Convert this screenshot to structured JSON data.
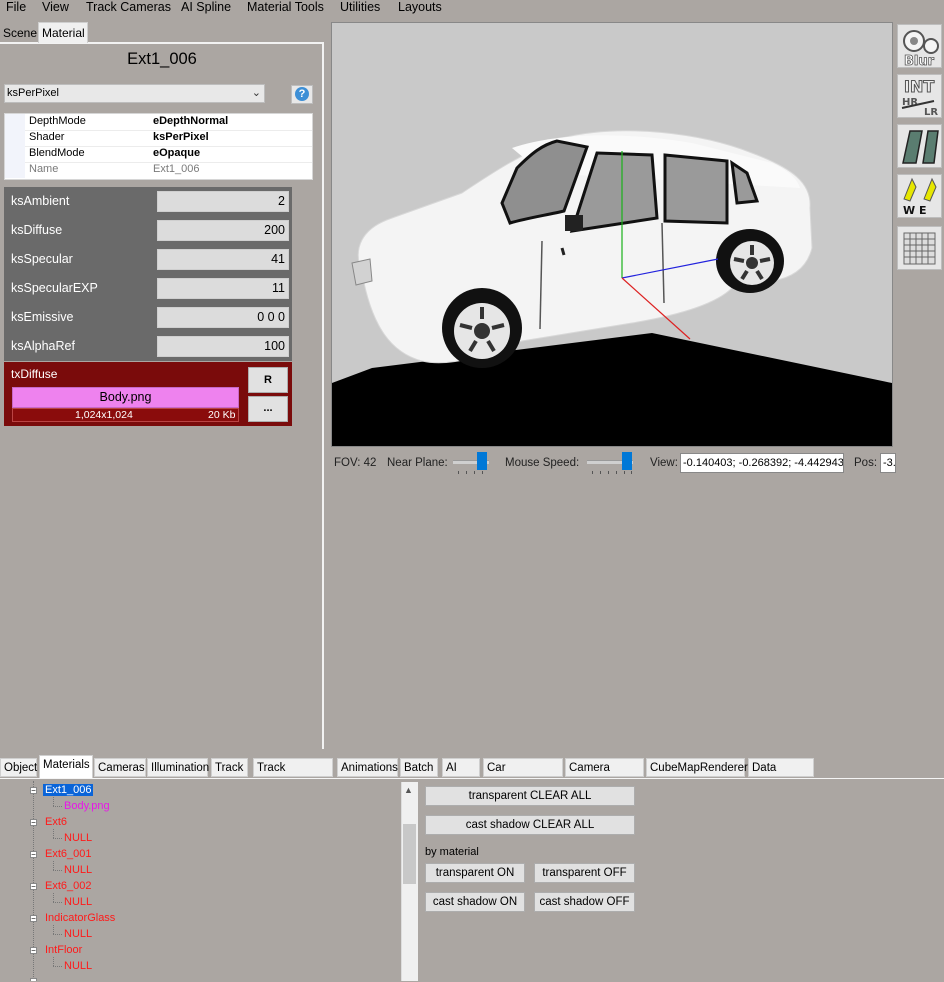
{
  "menu": [
    "File",
    "View",
    "Track Cameras",
    "AI Spline",
    "Material Tools",
    "Utilities",
    "Layouts"
  ],
  "left_tabs": [
    "Scene",
    "Material"
  ],
  "material": {
    "name": "Ext1_006",
    "shader_select": "ksPerPixel",
    "props": [
      {
        "key": "DepthMode",
        "value": "eDepthNormal"
      },
      {
        "key": "Shader",
        "value": "ksPerPixel"
      },
      {
        "key": "BlendMode",
        "value": "eOpaque"
      },
      {
        "key": "Name",
        "value": "Ext1_006"
      }
    ],
    "params": [
      {
        "name": "ksAmbient",
        "value": "2"
      },
      {
        "name": "ksDiffuse",
        "value": "200"
      },
      {
        "name": "ksSpecular",
        "value": "41"
      },
      {
        "name": "ksSpecularEXP",
        "value": "11"
      },
      {
        "name": "ksEmissive",
        "value": "0 0 0"
      },
      {
        "name": "ksAlphaRef",
        "value": "100"
      }
    ],
    "texture": {
      "slot": "txDiffuse",
      "file": "Body.png",
      "dims": "1,024x1,024",
      "size": "20 Kb",
      "reload_label": "R",
      "browse_label": "..."
    }
  },
  "viewport_status": {
    "fov": "FOV: 42",
    "near_plane_label": "Near Plane:",
    "mouse_speed_label": "Mouse Speed:",
    "view_label": "View:",
    "view_value": "-0.140403; -0.268392; -4.442943",
    "pos_label": "Pos:",
    "pos_value": "-3."
  },
  "toolbar_icons": [
    {
      "icon": "blur-icon",
      "label": "Blur"
    },
    {
      "icon": "interior-icon",
      "label": "INT"
    },
    {
      "icon": "glass-icon",
      "label": ""
    },
    {
      "icon": "wipers-icon",
      "label": "W E"
    },
    {
      "icon": "grid-icon",
      "label": ""
    }
  ],
  "bottom_tabs": [
    "Object",
    "Materials",
    "Cameras",
    "Illumination",
    "Track",
    "Track Cameras",
    "Animations",
    "Batch",
    "AI",
    "Car Animations",
    "Camera Spline",
    "CubeMapRenderer",
    "Data Scripts"
  ],
  "tree": [
    {
      "name": "Ext1_006",
      "child": "Body.png",
      "selected": true
    },
    {
      "name": "Ext6",
      "child": "NULL"
    },
    {
      "name": "Ext6_001",
      "child": "NULL"
    },
    {
      "name": "Ext6_002",
      "child": "NULL"
    },
    {
      "name": "IndicatorGlass",
      "child": "NULL"
    },
    {
      "name": "IntFloor",
      "child": "NULL"
    }
  ],
  "actions": {
    "transparent_clear": "transparent CLEAR ALL",
    "shadow_clear": "cast shadow CLEAR ALL",
    "by_material": "by material",
    "transparent_on": "transparent ON",
    "transparent_off": "transparent OFF",
    "shadow_on": "cast shadow ON",
    "shadow_off": "cast shadow OFF"
  },
  "colors": {
    "background": "#aba6a2",
    "texture_panel": "#7a0b0b",
    "texture_file": "#ee82ee",
    "tree_text": "#ff1a1a",
    "selected_tree": "#0a64d8",
    "slider": "#0078d7"
  }
}
